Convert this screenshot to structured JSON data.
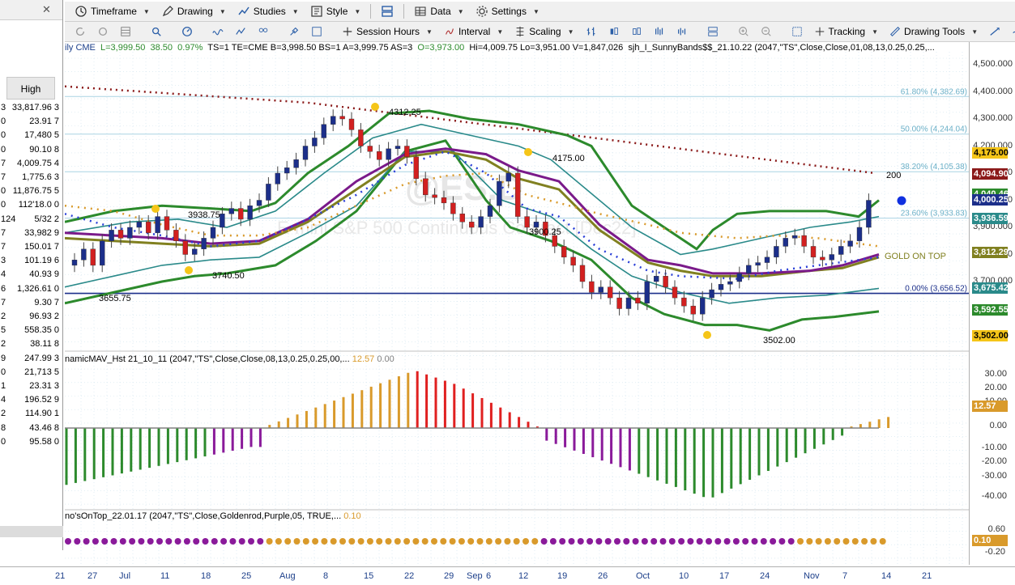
{
  "toolbar1": {
    "items": [
      {
        "label": "Timeframe"
      },
      {
        "label": "Drawing"
      },
      {
        "label": "Studies"
      },
      {
        "label": "Style"
      },
      {
        "label": "Data"
      },
      {
        "label": "Settings"
      }
    ]
  },
  "toolbar2": {
    "session_hours": "Session Hours",
    "interval": "Interval",
    "scaling": "Scaling",
    "tracking": "Tracking",
    "drawing_tools": "Drawing Tools"
  },
  "status": {
    "prefix": "ily  CME",
    "last": "L=3,999.50",
    "change": "38.50",
    "pct": "0.97%",
    "rest": "TS=1  TE=CME  B=3,998.50  BS=1  A=3,999.75  AS=3",
    "open": "O=3,973.00",
    "ohlv": "Hi=4,009.75  Lo=3,951.00  V=1,847,026",
    "study": "sjh_I_SunnyBands$$_21.10.22 (2047,\"TS\",Close,Close,01,08,13,0.25,0.25,..."
  },
  "left_panel": {
    "header": "High",
    "rows": [
      {
        "l": "3",
        "r": "33,817.96 3"
      },
      {
        "l": "0",
        "r": "23.91 7"
      },
      {
        "l": "0",
        "r": "17,480 5"
      },
      {
        "l": "0",
        "r": "90.10 8"
      },
      {
        "l": "7",
        "r": "4,009.75 4"
      },
      {
        "l": "7",
        "r": "1,775.6 3"
      },
      {
        "l": "0",
        "r": "11,876.75 5"
      },
      {
        "l": "0",
        "r": "112'18.0 0"
      },
      {
        "l": "124",
        "r": "5/32  2"
      },
      {
        "l": "7",
        "r": "33,982 9"
      },
      {
        "l": "7",
        "r": "150.01 7"
      },
      {
        "l": "3",
        "r": "101.19 6"
      },
      {
        "l": "4",
        "r": "40.93 9"
      },
      {
        "l": "6",
        "r": "1,326.61 0"
      },
      {
        "l": "7",
        "r": "9.30 7"
      },
      {
        "l": "2",
        "r": "96.93 2"
      },
      {
        "l": "5",
        "r": "558.35 0"
      },
      {
        "l": "2",
        "r": "38.11 8"
      },
      {
        "l": "9",
        "r": "247.99 3"
      },
      {
        "l": "0",
        "r": "21,713 5"
      },
      {
        "l": "1",
        "r": "23.31 3"
      },
      {
        "l": "4",
        "r": "196.52 9"
      },
      {
        "l": "2",
        "r": "114.90 1"
      },
      {
        "l": "8",
        "r": "43.46 8"
      },
      {
        "l": "0",
        "r": "95.58 0"
      }
    ]
  },
  "chart_data": {
    "type": "candlestick",
    "instrument_watermark": "@ES.D",
    "instrument_name": "E-mini S&P 500 Continuous Contract [Dec22]",
    "price_axis": {
      "min": 3500,
      "max": 4500,
      "ticks": [
        4500,
        4400,
        4300,
        4200,
        4100,
        4000,
        3900,
        3800,
        3700
      ]
    },
    "price_flags": [
      {
        "value": "4,175.00",
        "color": "#f5c518",
        "text_color": "#000"
      },
      {
        "value": "4,094.90",
        "color": "#8b1a1a",
        "text_color": "#fff"
      },
      {
        "value": "4,040.46",
        "color": "#2c8a2c",
        "text_color": "#fff"
      },
      {
        "value": "4,000.25",
        "color": "#1c2f8a",
        "text_color": "#fff"
      },
      {
        "value": "3,936.59",
        "color": "#2a8a8a",
        "text_color": "#fff"
      },
      {
        "value": "3,812.29",
        "color": "#808020",
        "text_color": "#fff"
      },
      {
        "value": "3,675.42",
        "color": "#2a8a8a",
        "text_color": "#fff"
      },
      {
        "value": "3,592.55",
        "color": "#2c8a2c",
        "text_color": "#fff"
      },
      {
        "value": "3,502.00",
        "color": "#f5c518",
        "text_color": "#000"
      }
    ],
    "fib_levels": [
      {
        "label": "61.80% (4,382.69)",
        "value": 4382.69
      },
      {
        "label": "50.00% (4,244.04)",
        "value": 4244.04
      },
      {
        "label": "38.20% (4,105.38)",
        "value": 4105.38
      },
      {
        "label": "23.60% (3,933.83)",
        "value": 3933.83
      },
      {
        "label": "0.00% (3,656.52)",
        "value": 3656.52
      }
    ],
    "annotations": [
      {
        "text": "4312.25"
      },
      {
        "text": "4175.00"
      },
      {
        "text": "3938.75"
      },
      {
        "text": "3900.25"
      },
      {
        "text": "3740.50"
      },
      {
        "text": "3655.75"
      },
      {
        "text": "3502.00"
      },
      {
        "text": "200"
      },
      {
        "text": "GOLD ON TOP"
      }
    ],
    "x_labels": [
      "21",
      "27",
      "Jul",
      "11",
      "18",
      "25",
      "Aug",
      "8",
      "15",
      "22",
      "29",
      "Sep",
      "6",
      "12",
      "19",
      "26",
      "Oct",
      "10",
      "17",
      "24",
      "Nov",
      "7",
      "14",
      "21"
    ],
    "histogram": {
      "title": "namicMAV_Hst 21_10_11 (2047,\"TS\",Close,Close,08,13,0.25,0.25,00,...",
      "value1": "12.57",
      "value2": "0.00",
      "ticks": [
        "30.00",
        "20.00",
        "10.00",
        "0.00",
        "-10.00",
        "-20.00",
        "-30.00",
        "-40.00"
      ],
      "flag": "12.57"
    },
    "dots_panel": {
      "title": "no'sOnTop_22.01.17 (2047,\"TS\",Close,Goldenrod,Purple,05, TRUE,...",
      "value": "0.10",
      "ticks": [
        "0.60",
        "0.20",
        "-0.20"
      ],
      "flag": "0.10"
    }
  }
}
